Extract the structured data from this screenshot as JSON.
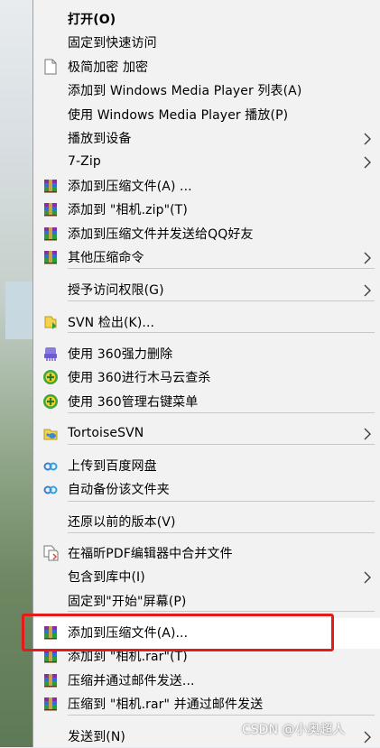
{
  "menu": {
    "items": [
      {
        "label": "打开(O)",
        "bold": true,
        "icon": "none",
        "submenu": false
      },
      {
        "label": "固定到快速访问",
        "icon": "none",
        "submenu": false
      },
      {
        "label": "极简加密 加密",
        "icon": "file-icon",
        "submenu": false
      },
      {
        "label": "添加到 Windows Media Player 列表(A)",
        "icon": "none",
        "submenu": false
      },
      {
        "label": "使用 Windows Media Player 播放(P)",
        "icon": "none",
        "submenu": false
      },
      {
        "label": "播放到设备",
        "icon": "none",
        "submenu": true
      },
      {
        "label": "7-Zip",
        "icon": "none",
        "submenu": true
      },
      {
        "label": "添加到压缩文件(A) ...",
        "icon": "winrar-icon",
        "submenu": false
      },
      {
        "label": "添加到 \"相机.zip\"(T)",
        "icon": "winrar-icon",
        "submenu": false
      },
      {
        "label": "添加到压缩文件并发送给QQ好友",
        "icon": "winrar-icon",
        "submenu": false
      },
      {
        "label": "其他压缩命令",
        "icon": "winrar-icon",
        "submenu": true
      },
      {
        "label": "授予访问权限(G)",
        "icon": "none",
        "submenu": true
      },
      {
        "label": "SVN 检出(K)...",
        "icon": "svn-checkout-icon",
        "submenu": false
      },
      {
        "label": "使用 360强力删除",
        "icon": "shredder-icon",
        "submenu": false
      },
      {
        "label": "使用 360进行木马云查杀",
        "icon": "shield-360-icon",
        "submenu": false
      },
      {
        "label": "使用 360管理右键菜单",
        "icon": "shield-360-icon",
        "submenu": false
      },
      {
        "label": "TortoiseSVN",
        "icon": "tortoisesvn-icon",
        "submenu": true
      },
      {
        "label": "上传到百度网盘",
        "icon": "baidu-cloud-icon",
        "submenu": false
      },
      {
        "label": "自动备份该文件夹",
        "icon": "baidu-cloud-icon",
        "submenu": false
      },
      {
        "label": "还原以前的版本(V)",
        "icon": "none",
        "submenu": false
      },
      {
        "label": "在福昕PDF编辑器中合并文件",
        "icon": "pdf-merge-icon",
        "submenu": false
      },
      {
        "label": "包含到库中(I)",
        "icon": "none",
        "submenu": true
      },
      {
        "label": "固定到\"开始\"屏幕(P)",
        "icon": "none",
        "submenu": false
      },
      {
        "label": "添加到压缩文件(A)...",
        "icon": "winrar-icon",
        "submenu": false
      },
      {
        "label": "添加到 \"相机.rar\"(T)",
        "icon": "winrar-icon",
        "submenu": false
      },
      {
        "label": "压缩并通过邮件发送...",
        "icon": "winrar-icon",
        "submenu": false
      },
      {
        "label": "压缩到 \"相机.rar\" 并通过邮件发送",
        "icon": "winrar-icon",
        "submenu": false
      },
      {
        "label": "发送到(N)",
        "icon": "none",
        "submenu": true
      }
    ],
    "highlighted_label": "添加到压缩文件(A)..."
  },
  "watermark": "CSDN @小奥超人",
  "colors": {
    "menu_bg": "#f2f2f2",
    "highlight_box": "#e31b1b",
    "separator": "#c8c8c8"
  }
}
